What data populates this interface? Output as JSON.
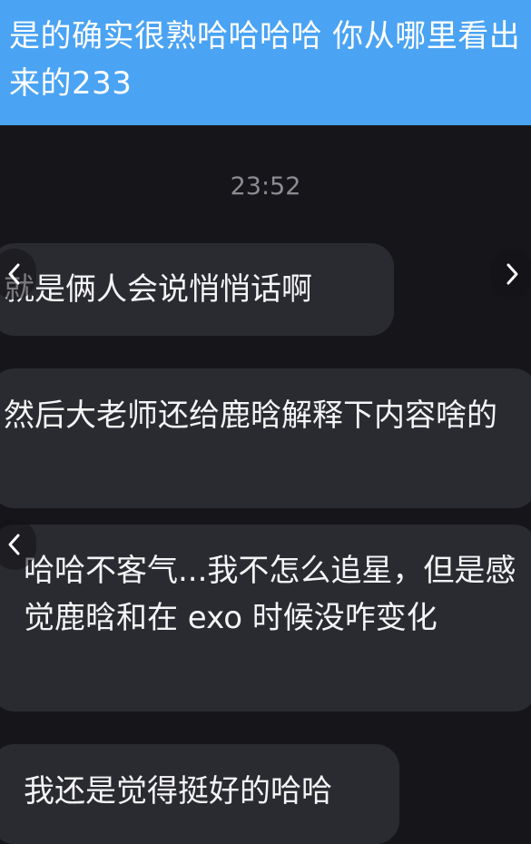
{
  "outgoing_message": {
    "text": "是的确实很熟哈哈哈哈 你从哪里看出来的233"
  },
  "timestamp": "23:52",
  "incoming_messages": [
    {
      "text": "就是俩人会说悄悄话啊"
    },
    {
      "text": "然后大老师还给鹿晗解释下内容啥的"
    },
    {
      "text": "哈哈不客气...我不怎么追星，但是感觉鹿晗和在 exo 时候没咋变化"
    },
    {
      "text": "我还是觉得挺好的哈哈"
    }
  ],
  "icons": {
    "prev": "chevron-left-icon",
    "next": "chevron-right-icon"
  }
}
